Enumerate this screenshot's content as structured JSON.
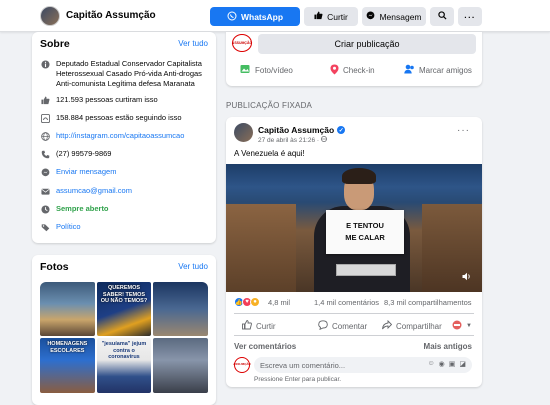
{
  "header": {
    "page_name": "Capitão Assumção",
    "whatsapp_label": "WhatsApp",
    "curtir_label": "Curtir",
    "mensagem_label": "Mensagem",
    "search_icon": "search-icon",
    "more_icon": "more-icon"
  },
  "sobre": {
    "title": "Sobre",
    "ver_tudo": "Ver tudo",
    "description": "Deputado Estadual Conservador Capitalista Heterossexual Casado Pró-vida Anti-drogas Anti-comunista Legítima defesa Maranata",
    "likes": "121.593 pessoas curtiram isso",
    "followers": "158.884 pessoas estão seguindo isso",
    "instagram": "http://instagram.com/capitaoassumcao",
    "phone": "(27) 99579-9869",
    "send_message": "Enviar mensagem",
    "email": "assumcao@gmail.com",
    "hours": "Sempre aberto",
    "category": "Político"
  },
  "fotos": {
    "title": "Fotos",
    "ver_tudo": "Ver tudo",
    "items": [
      {
        "caption": ""
      },
      {
        "caption": "QUEREMOS SABER! TEMOS OU NÃO TEMOS?"
      },
      {
        "caption": ""
      },
      {
        "caption": "HOMENAGENS ESCOLARES"
      },
      {
        "caption": "\"jesuíama\" jejum contra o coronavírus"
      },
      {
        "caption": ""
      }
    ]
  },
  "create": {
    "avatar_text": "ASSUMÇÃO",
    "button_label": "Criar publicação",
    "photo_video": "Foto/vídeo",
    "checkin": "Check-in",
    "tag_friends": "Marcar amigos"
  },
  "pinned_label": "PUBLICAÇÃO FIXADA",
  "post": {
    "author": "Capitão Assumção",
    "date": "27 de abril às 21:26 · ",
    "text": "A Venezuela é aqui!",
    "sign_line1": "E TENTOU",
    "sign_line2": "ME CALAR",
    "reactions_count": "4,8 mil",
    "comments_count": "1,4 mil comentários",
    "shares_count": "8,3 mil compartilhamentos",
    "like_label": "Curtir",
    "comment_label": "Comentar",
    "share_label": "Compartilhar",
    "view_comments": "Ver comentários",
    "more_recent": "Mais antigos",
    "comment_placeholder": "Escreva um comentário...",
    "enter_hint": "Pressione Enter para publicar."
  },
  "colors": {
    "primary": "#1877f2",
    "background": "#f0f2f5",
    "green": "#31a24c"
  }
}
